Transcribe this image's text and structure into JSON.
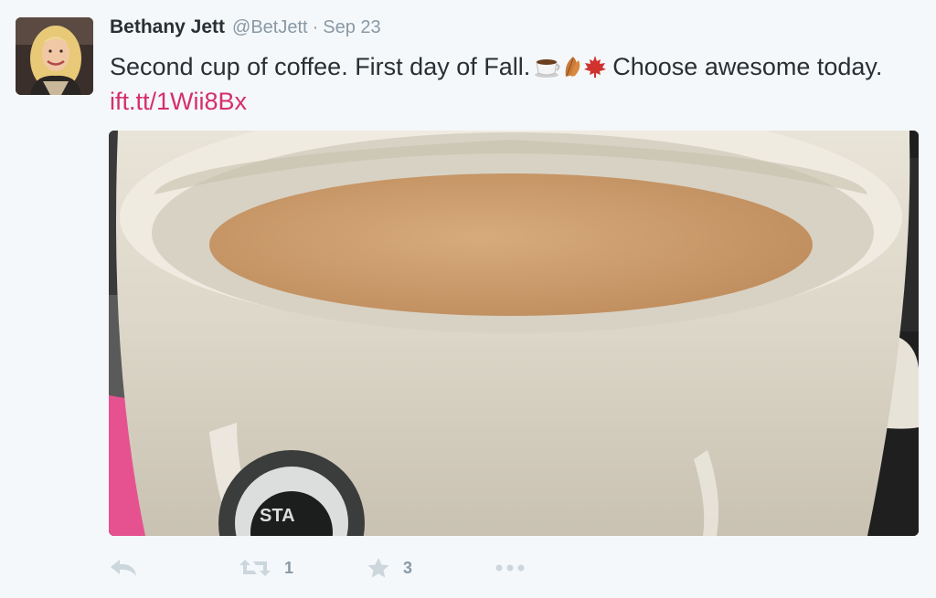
{
  "tweet": {
    "author_name": "Bethany Jett",
    "author_handle": "@BetJett",
    "separator": "·",
    "timestamp": "Sep 23",
    "text_before_emoji": "Second cup of coffee. First day of Fall.",
    "emojis": [
      "coffee-cup-icon",
      "fallen-leaf-icon",
      "maple-leaf-icon"
    ],
    "text_after_emoji": "Choose awesome today.",
    "link_text": "ift.tt/1Wii8Bx",
    "link_color": "#d62e6b"
  },
  "actions": {
    "reply_icon": "reply-icon",
    "retweet_icon": "retweet-icon",
    "retweet_count": "1",
    "favorite_icon": "star-icon",
    "favorite_count": "3",
    "more_icon": "more-dots-icon"
  },
  "colors": {
    "background": "#f5f8fa",
    "text": "#292f33",
    "muted": "#8899a6",
    "icon": "#ccd6dd"
  }
}
